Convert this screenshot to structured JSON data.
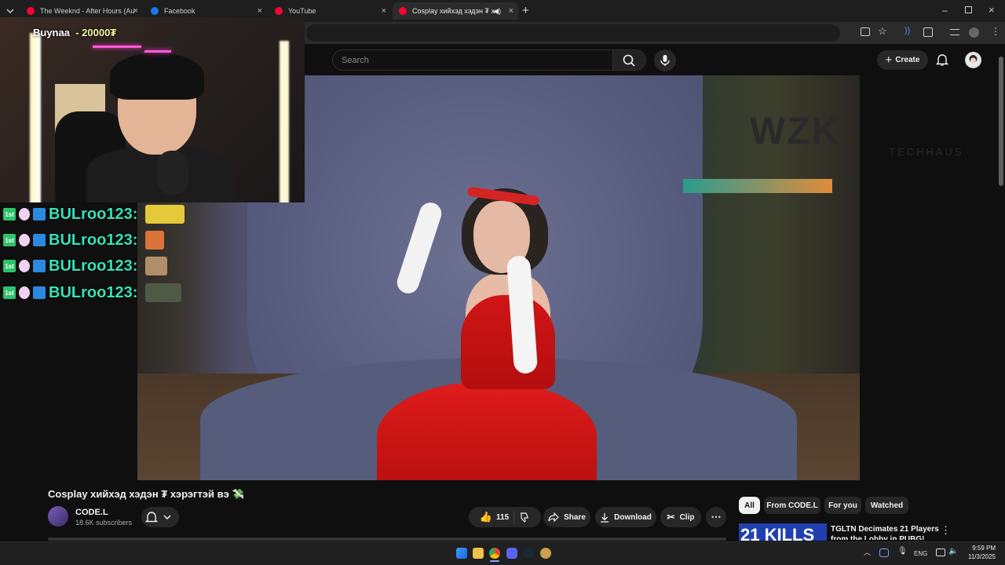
{
  "browser": {
    "tabs": [
      {
        "title": "The Weeknd - After Hours (Au",
        "favicon": "youtube-icon",
        "color": "#ff0033"
      },
      {
        "title": "Facebook",
        "favicon": "facebook-icon",
        "color": "#1877f2"
      },
      {
        "title": "YouTube",
        "favicon": "youtube-icon",
        "color": "#ff0033"
      },
      {
        "title": "Cosplay хийхэд хэдэн ₮ хэр",
        "favicon": "youtube-icon",
        "color": "#ff0033",
        "active": true
      }
    ],
    "new_tab": "+",
    "window_controls": [
      "minimize",
      "restore",
      "close"
    ]
  },
  "youtube": {
    "search_placeholder": "Search",
    "create_label": "Create"
  },
  "stream_overlay": {
    "donor_name": "Buynaa",
    "donor_amount": "- 20000₮",
    "chat": [
      {
        "badge": "1st",
        "name": "BULroo123:",
        "emote_color": "#e4c93a"
      },
      {
        "badge": "1st",
        "name": "BULroo123:",
        "emote_color": "#d9743a"
      },
      {
        "badge": "1st",
        "name": "BULroo123:",
        "emote_color": "#b08e6a"
      },
      {
        "badge": "1st",
        "name": "BULroo123:",
        "emote_color": "#4f5a44"
      }
    ]
  },
  "video": {
    "title": "Cosplay хийхэд хэдэн ₮ хэрэгтэй вэ",
    "title_icon": "💸",
    "watermark": "WZK",
    "watermark_sub": "TECHHAUS"
  },
  "channel": {
    "name": "CODE.L",
    "subscribers": "18.6K subscribers"
  },
  "actions": {
    "likes": "115",
    "share": "Share",
    "download": "Download",
    "clip": "Clip"
  },
  "chips": [
    {
      "label": "All",
      "selected": true
    },
    {
      "label": "From CODE.L",
      "selected": false
    },
    {
      "label": "For you",
      "selected": false
    },
    {
      "label": "Watched",
      "selected": false
    }
  ],
  "recommendation": {
    "thumb_text": "21 KILLS",
    "title": "TGLTN Decimates 21 Players from the Lobby in PUBG!"
  },
  "taskbar": {
    "language": "ENG",
    "time": "9:59 PM",
    "date": "11/3/2025"
  }
}
